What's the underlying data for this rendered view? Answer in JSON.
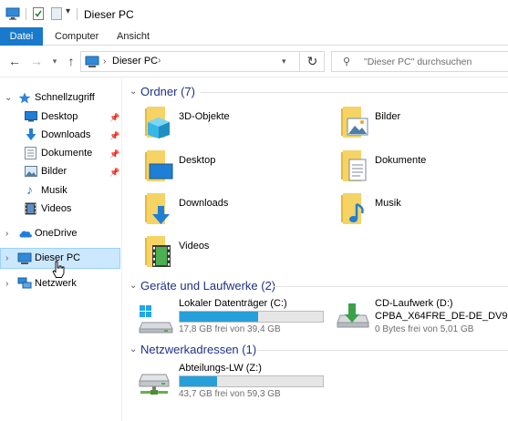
{
  "window": {
    "title": "Dieser PC"
  },
  "ribbon": {
    "tabs": [
      "Datei",
      "Computer",
      "Ansicht"
    ]
  },
  "address": {
    "location": "Dieser PC",
    "search_placeholder": "\"Dieser PC\" durchsuchen"
  },
  "sidebar": {
    "quick_access": "Schnellzugriff",
    "quick_items": [
      "Desktop",
      "Downloads",
      "Dokumente",
      "Bilder",
      "Musik",
      "Videos"
    ],
    "onedrive": "OneDrive",
    "this_pc": "Dieser PC",
    "network": "Netzwerk"
  },
  "groups": {
    "folders": {
      "header": "Ordner (7)",
      "items": [
        "3D-Objekte",
        "Bilder",
        "Desktop",
        "Dokumente",
        "Downloads",
        "Musik",
        "Videos"
      ]
    },
    "drives": {
      "header": "Geräte und Laufwerke (2)",
      "local": {
        "name": "Lokaler Datenträger (C:)",
        "free": "17,8 GB frei von 39,4 GB",
        "used_fraction": 0.55
      },
      "cd": {
        "name": "CD-Laufwerk (D:)",
        "label": "CPBA_X64FRE_DE-DE_DV9",
        "free": "0 Bytes frei von 5,01 GB"
      }
    },
    "network": {
      "header": "Netzwerkadressen (1)",
      "share": {
        "name": "Abteilungs-LW (Z:)",
        "free": "43,7 GB frei von 59,3 GB",
        "used_fraction": 0.26
      }
    }
  },
  "colors": {
    "accent": "#1979ca",
    "group_header": "#1e3287",
    "progress": "#26a0da",
    "selection": "#cce8ff"
  }
}
